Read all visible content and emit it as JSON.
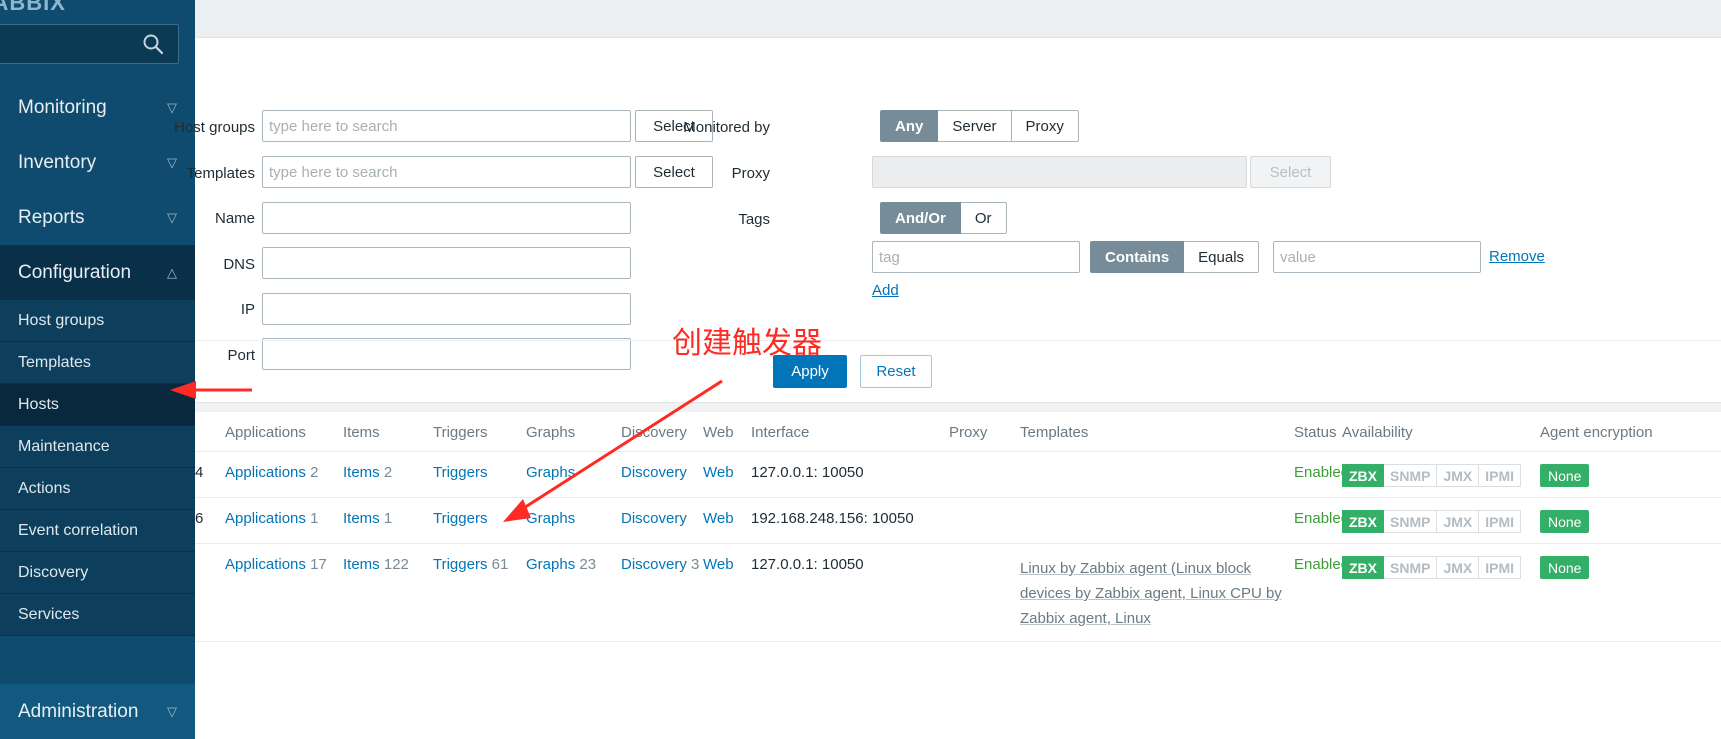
{
  "sidebar": {
    "logo": "ZABBIX",
    "search_placeholder": "",
    "search_value": "",
    "items": [
      {
        "label": "Monitoring",
        "caret": "chevron-down",
        "state": "collapsed"
      },
      {
        "label": "Inventory",
        "caret": "chevron-down",
        "state": "collapsed"
      },
      {
        "label": "Reports",
        "caret": "chevron-down",
        "state": "collapsed"
      },
      {
        "label": "Configuration",
        "caret": "chevron-up",
        "state": "expanded"
      }
    ],
    "configuration_children": [
      {
        "label": "Host groups",
        "selected": false
      },
      {
        "label": "Templates",
        "selected": false
      },
      {
        "label": "Hosts",
        "selected": true
      },
      {
        "label": "Maintenance",
        "selected": false
      },
      {
        "label": "Actions",
        "selected": false
      },
      {
        "label": "Event correlation",
        "selected": false
      },
      {
        "label": "Discovery",
        "selected": false
      },
      {
        "label": "Services",
        "selected": false
      }
    ],
    "bottom": {
      "label": "Administration",
      "caret": "chevron-down"
    }
  },
  "filter": {
    "host_groups": {
      "label": "Host groups",
      "placeholder": "type here to search",
      "value": "",
      "select_label": "Select"
    },
    "templates": {
      "label": "Templates",
      "placeholder": "type here to search",
      "value": "",
      "select_label": "Select"
    },
    "name": {
      "label": "Name",
      "value": ""
    },
    "dns": {
      "label": "DNS",
      "value": ""
    },
    "ip": {
      "label": "IP",
      "value": ""
    },
    "port": {
      "label": "Port",
      "value": ""
    },
    "monitored_by": {
      "label": "Monitored by",
      "options": [
        "Any",
        "Server",
        "Proxy"
      ],
      "selected": "Any"
    },
    "proxy": {
      "label": "Proxy",
      "value": "",
      "select_label": "Select",
      "disabled": true
    },
    "tags": {
      "label": "Tags",
      "operator_options": [
        "And/Or",
        "Or"
      ],
      "operator_selected": "And/Or",
      "tag_placeholder": "tag",
      "tag_value": "",
      "match_options": [
        "Contains",
        "Equals"
      ],
      "match_selected": "Contains",
      "value_placeholder": "value",
      "value_value": "",
      "remove_label": "Remove",
      "add_label": "Add"
    },
    "apply_label": "Apply",
    "reset_label": "Reset"
  },
  "table": {
    "headers": [
      "",
      "Applications",
      "Items",
      "Triggers",
      "Graphs",
      "Discovery",
      "Web",
      "Interface",
      "Proxy",
      "Templates",
      "Status",
      "Availability",
      "Agent encryption"
    ],
    "availability_labels": [
      "ZBX",
      "SNMP",
      "JMX",
      "IPMI"
    ],
    "rows": [
      {
        "name_fragment": "4",
        "applications": {
          "label": "Applications",
          "count": "2"
        },
        "items": {
          "label": "Items",
          "count": "2"
        },
        "triggers": {
          "label": "Triggers",
          "count": ""
        },
        "graphs": {
          "label": "Graphs",
          "count": ""
        },
        "discovery": {
          "label": "Discovery",
          "count": ""
        },
        "web": {
          "label": "Web",
          "count": ""
        },
        "interface": "127.0.0.1: 10050",
        "proxy": "",
        "templates": "",
        "status": "Enabled",
        "availability_active": [
          "ZBX"
        ],
        "agent_encryption": "None"
      },
      {
        "name_fragment": "6",
        "applications": {
          "label": "Applications",
          "count": "1"
        },
        "items": {
          "label": "Items",
          "count": "1"
        },
        "triggers": {
          "label": "Triggers",
          "count": ""
        },
        "graphs": {
          "label": "Graphs",
          "count": ""
        },
        "discovery": {
          "label": "Discovery",
          "count": ""
        },
        "web": {
          "label": "Web",
          "count": ""
        },
        "interface": "192.168.248.156: 10050",
        "proxy": "",
        "templates": "",
        "status": "Enabled",
        "availability_active": [
          "ZBX"
        ],
        "agent_encryption": "None"
      },
      {
        "name_fragment": "",
        "applications": {
          "label": "Applications",
          "count": "17"
        },
        "items": {
          "label": "Items",
          "count": "122"
        },
        "triggers": {
          "label": "Triggers",
          "count": "61"
        },
        "graphs": {
          "label": "Graphs",
          "count": "23"
        },
        "discovery": {
          "label": "Discovery",
          "count": "3"
        },
        "web": {
          "label": "Web",
          "count": ""
        },
        "interface": "127.0.0.1: 10050",
        "proxy": "",
        "templates": "Linux by Zabbix agent (Linux block devices by Zabbix agent, Linux CPU by Zabbix agent, Linux",
        "status": "Enabled",
        "availability_active": [
          "ZBX"
        ],
        "agent_encryption": "None"
      }
    ]
  },
  "annotations": {
    "create_trigger_text": "创建触发器"
  }
}
